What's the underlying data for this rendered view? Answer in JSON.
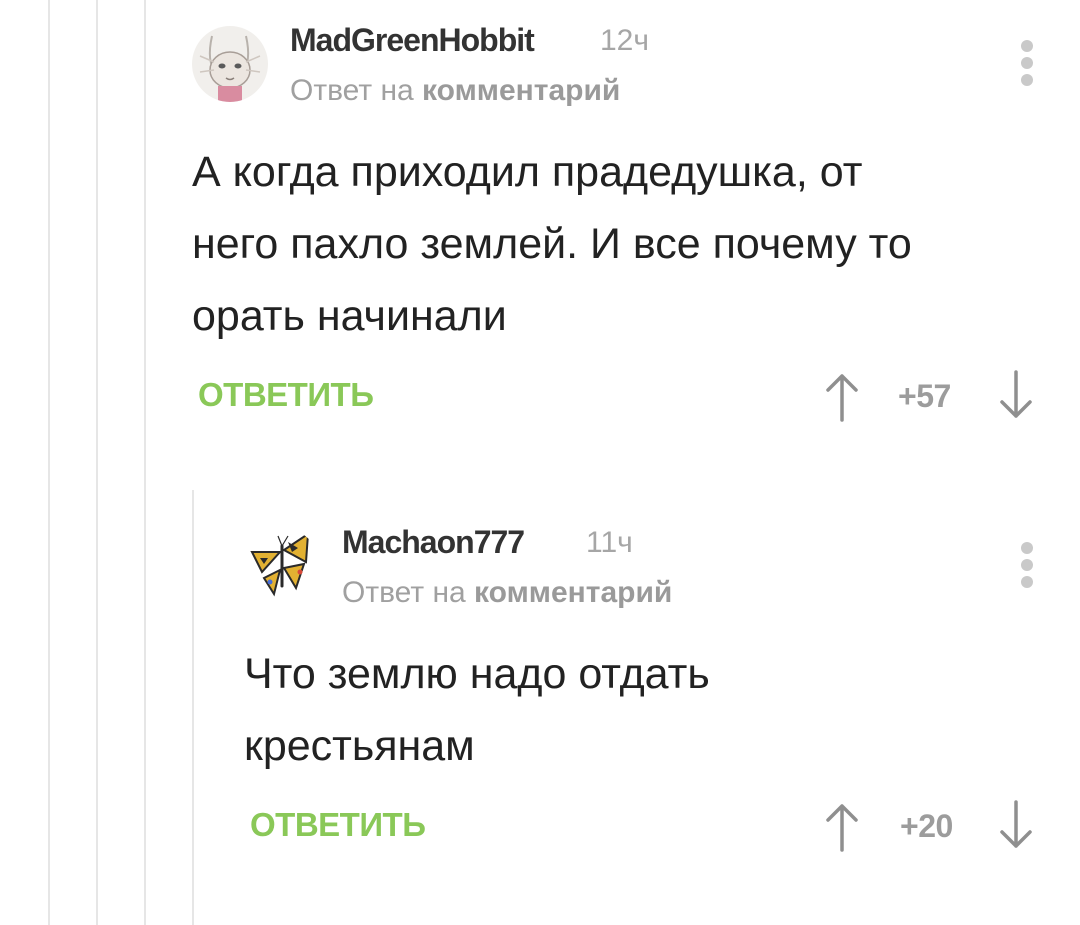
{
  "comments": [
    {
      "author": "MadGreenHobbit",
      "time": "12ч",
      "reply_prefix": "Ответ на",
      "reply_link": "комментарий",
      "text": "А когда приходил прадедушка, от\nнего пахло землей. И все почему то\nорать начинали",
      "reply_label": "ОТВЕТИТЬ",
      "rating": "+57"
    },
    {
      "author": "Machaon777",
      "time": "11ч",
      "reply_prefix": "Ответ на",
      "reply_link": "комментарий",
      "text": "Что землю надо отдать\nкрестьянам",
      "reply_label": "ОТВЕТИТЬ",
      "rating": "+20"
    }
  ],
  "colors": {
    "reply": "#8ac858",
    "muted": "#a0a0a0",
    "thread_line": "#e6e6e6"
  },
  "icons": [
    "more-vertical-icon",
    "arrow-up-icon",
    "arrow-down-icon"
  ]
}
